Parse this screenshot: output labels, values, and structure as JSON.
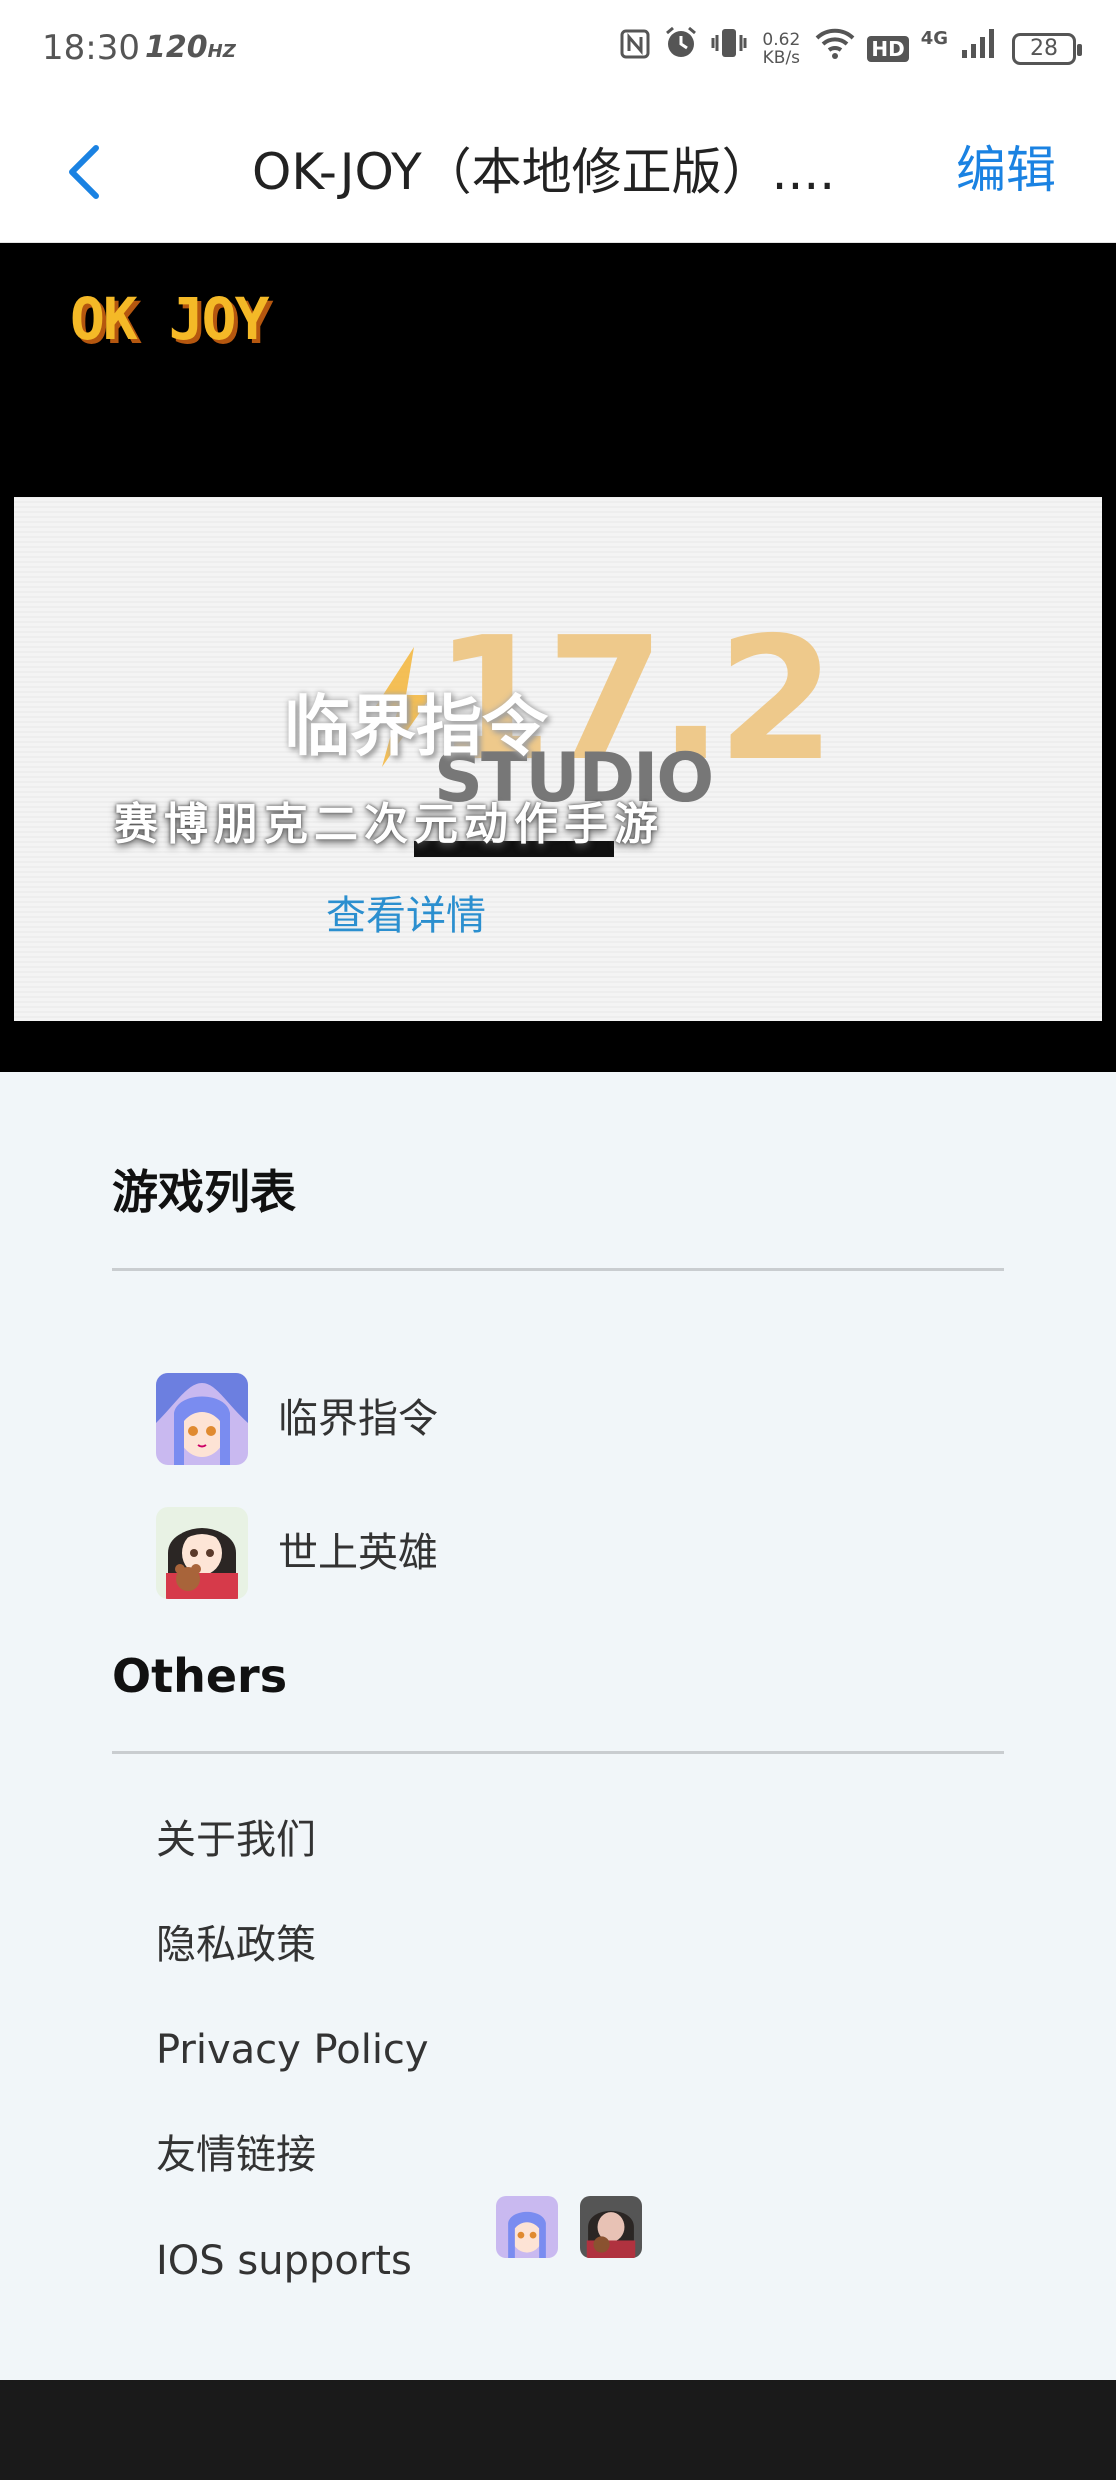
{
  "status_bar": {
    "time": "18:30",
    "refresh_rate": "120",
    "net_speed_value": "0.62",
    "net_speed_unit": "KB/s",
    "hd": "HD",
    "network": "4G",
    "battery": "28",
    "icons": [
      "nfc-icon",
      "alarm-icon",
      "vibrate-icon",
      "wifi-icon",
      "signal-icon",
      "battery-icon"
    ]
  },
  "nav": {
    "back_icon": "chevron-left-icon",
    "title": "OK-JOY（本地修正版）....",
    "edit_label": "编辑",
    "accent_color": "#1a82e2"
  },
  "banner": {
    "site_logo": "OK JOY",
    "studio_number": "17.2",
    "studio_word": "STUDIO",
    "game_logo": "临界指令",
    "slogan": "赛博朋克二次元动作手游",
    "detail_link": "查看详情"
  },
  "games_section": {
    "title": "游戏列表",
    "items": [
      {
        "name": "临界指令",
        "icon": "anime-girl-blue-hair-icon"
      },
      {
        "name": "世上英雄",
        "icon": "anime-girl-teddy-bear-icon"
      }
    ]
  },
  "others_section": {
    "title": "Others",
    "items": [
      {
        "label": "关于我们"
      },
      {
        "label": "隐私政策"
      },
      {
        "label": "Privacy Policy"
      },
      {
        "label": "友情链接"
      },
      {
        "label": "IOS supports"
      }
    ]
  }
}
